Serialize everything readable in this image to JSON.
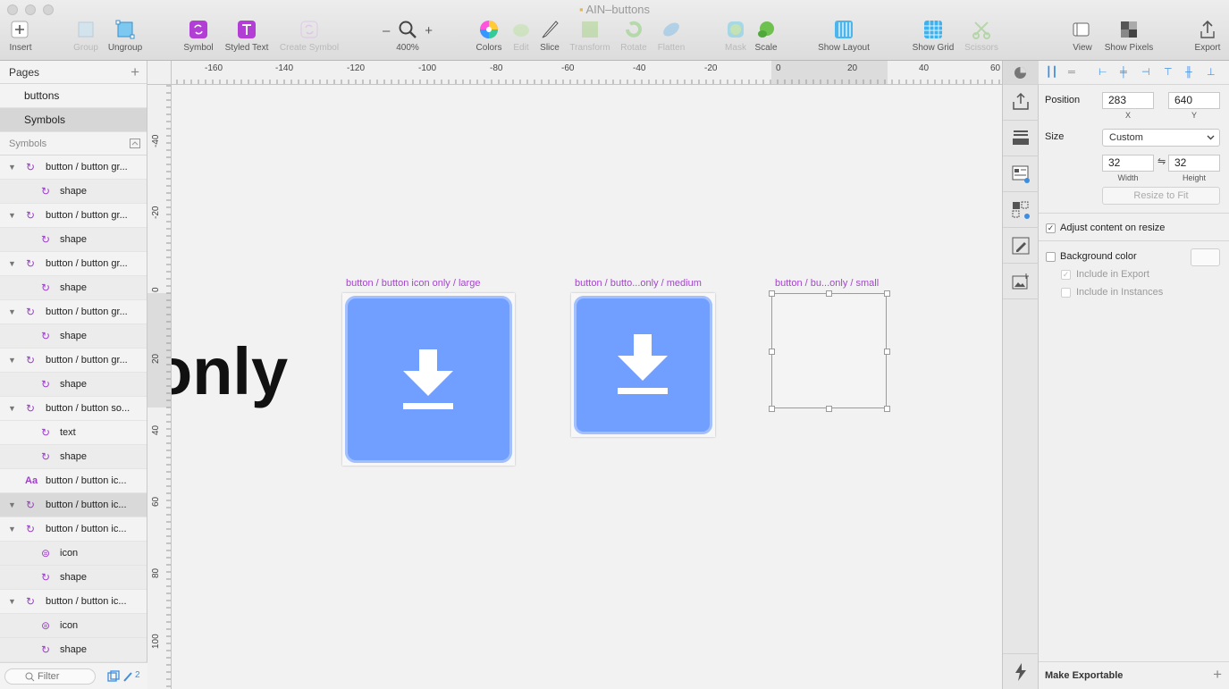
{
  "window": {
    "title": "AIN–buttons"
  },
  "toolbar": {
    "insert": "Insert",
    "group": "Group",
    "ungroup": "Ungroup",
    "symbol": "Symbol",
    "styled_text": "Styled Text",
    "create_symbol": "Create Symbol",
    "zoom_minus": "–",
    "zoom_plus": "+",
    "zoom_level": "400%",
    "colors": "Colors",
    "edit": "Edit",
    "slice": "Slice",
    "transform": "Transform",
    "rotate": "Rotate",
    "flatten": "Flatten",
    "mask": "Mask",
    "scale": "Scale",
    "show_layout": "Show Layout",
    "show_grid": "Show Grid",
    "scissors": "Scissors",
    "view": "View",
    "show_pixels": "Show Pixels",
    "export": "Export"
  },
  "pages": {
    "header": "Pages",
    "add": "+",
    "items": [
      {
        "label": "buttons"
      },
      {
        "label": "Symbols"
      }
    ]
  },
  "layers": {
    "header": "Symbols",
    "items": [
      {
        "label": "button / button gr..."
      },
      {
        "label": "shape"
      },
      {
        "label": "button / button gr..."
      },
      {
        "label": "shape"
      },
      {
        "label": "button / button gr..."
      },
      {
        "label": "shape"
      },
      {
        "label": "button / button gr..."
      },
      {
        "label": "shape"
      },
      {
        "label": "button / button gr..."
      },
      {
        "label": "shape"
      },
      {
        "label": "button / button so..."
      },
      {
        "label": "text"
      },
      {
        "label": "shape"
      },
      {
        "label": "button / button ic..."
      },
      {
        "label": "button / button ic..."
      },
      {
        "label": "button / button ic..."
      },
      {
        "label": "icon"
      },
      {
        "label": "shape"
      },
      {
        "label": "button / button ic..."
      },
      {
        "label": "icon"
      },
      {
        "label": "shape"
      }
    ],
    "text_icon": "Aa",
    "filter_placeholder": "Filter",
    "badge_count": "2"
  },
  "rulers": {
    "horizontal": [
      "-160",
      "-140",
      "-120",
      "-100",
      "-80",
      "-60",
      "-40",
      "-20",
      "0",
      "20",
      "40",
      "60"
    ],
    "vertical": [
      "-40",
      "-20",
      "0",
      "20",
      "40",
      "60",
      "80",
      "100"
    ]
  },
  "canvas": {
    "partial_text": "only",
    "artboards": [
      {
        "label": "button / button icon only / large"
      },
      {
        "label": "button / butto...only / medium"
      },
      {
        "label": "button / bu...only / small"
      }
    ],
    "button_color": "#709fff"
  },
  "inspector": {
    "position_label": "Position",
    "x_value": "283",
    "y_value": "640",
    "x_label": "X",
    "y_label": "Y",
    "size_label": "Size",
    "size_option": "Custom",
    "width_value": "32",
    "height_value": "32",
    "width_label": "Width",
    "height_label": "Height",
    "resize_to_fit": "Resize to Fit",
    "adjust_content": "Adjust content on resize",
    "background_color": "Background color",
    "include_export": "Include in Export",
    "include_instances": "Include in Instances",
    "make_exportable": "Make Exportable",
    "make_exportable_add": "+"
  }
}
